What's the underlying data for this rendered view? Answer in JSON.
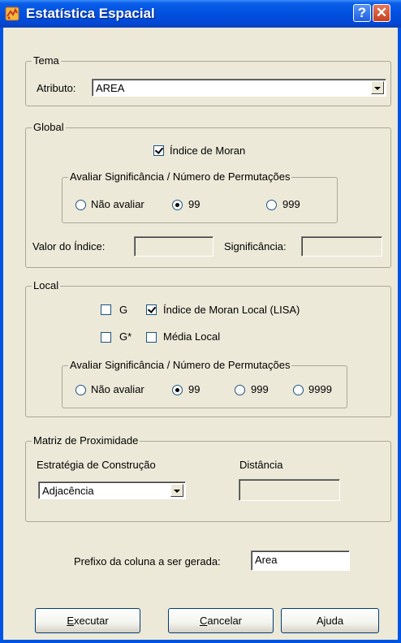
{
  "window": {
    "title": "Estatística Espacial"
  },
  "tema": {
    "legend": "Tema",
    "atributo_label": "Atributo:",
    "atributo_value": "AREA"
  },
  "global": {
    "legend": "Global",
    "indice_moran": {
      "label": "Índice de Moran",
      "checked": true
    },
    "significancia": {
      "legend": "Avaliar Significância / Número de Permutações",
      "options": [
        "Não avaliar",
        "99",
        "999"
      ],
      "selected": "99"
    },
    "valor_indice_label": "Valor do Índice:",
    "valor_indice_value": "",
    "significancia_label": "Significância:",
    "significancia_value": ""
  },
  "local": {
    "legend": "Local",
    "g": {
      "label": "G",
      "checked": false
    },
    "moran_local": {
      "label": "Índice de Moran Local (LISA)",
      "checked": true
    },
    "g_star": {
      "label": "G*",
      "checked": false
    },
    "media_local": {
      "label": "Média Local",
      "checked": false
    },
    "significancia": {
      "legend": "Avaliar Significância / Número de Permutações",
      "options": [
        "Não avaliar",
        "99",
        "999",
        "9999"
      ],
      "selected": "99"
    }
  },
  "matriz": {
    "legend": "Matriz de Proximidade",
    "estrategia_label": "Estratégia de Construção",
    "estrategia_value": "Adjacência",
    "distancia_label": "Distância",
    "distancia_value": ""
  },
  "prefixo": {
    "label": "Prefixo da coluna a ser gerada:",
    "value": "Area"
  },
  "buttons": {
    "executar": {
      "mnemonic": "E",
      "rest": "xecutar"
    },
    "cancelar": {
      "mnemonic": "C",
      "rest": "ancelar"
    },
    "ajuda": "Ajuda"
  },
  "colors": {
    "titlebar": "#0054e3",
    "dialog_bg": "#ece9d8",
    "close_button": "#c4401f"
  },
  "icons": [
    "app-icon",
    "help-icon",
    "close-icon",
    "dropdown-arrow-icon"
  ]
}
